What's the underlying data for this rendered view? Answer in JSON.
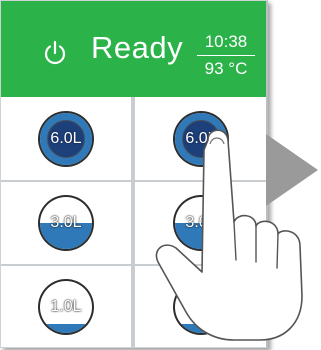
{
  "header": {
    "status": "Ready",
    "time": "10:38",
    "temperature": "93 °C",
    "background_color": "#2bb34a",
    "power_icon": "power-icon"
  },
  "volumes": [
    {
      "label": "6.0L",
      "level": 1.0
    },
    {
      "label": "6.0L",
      "level": 1.0
    },
    {
      "label": "3.0L",
      "level": 0.5
    },
    {
      "label": "3.0L",
      "level": 0.5
    },
    {
      "label": "1.0L",
      "level": 0.17
    },
    {
      "label": "1.0L",
      "level": 0.17
    }
  ],
  "colors": {
    "fill": "#2f79b9",
    "core": "#1d3f7a",
    "grid_line": "#c8cdd1",
    "arrow": "#9a9a9a"
  },
  "overlay": {
    "icon": "hand-pointer-icon",
    "arrow_icon": "arrow-right-icon"
  }
}
